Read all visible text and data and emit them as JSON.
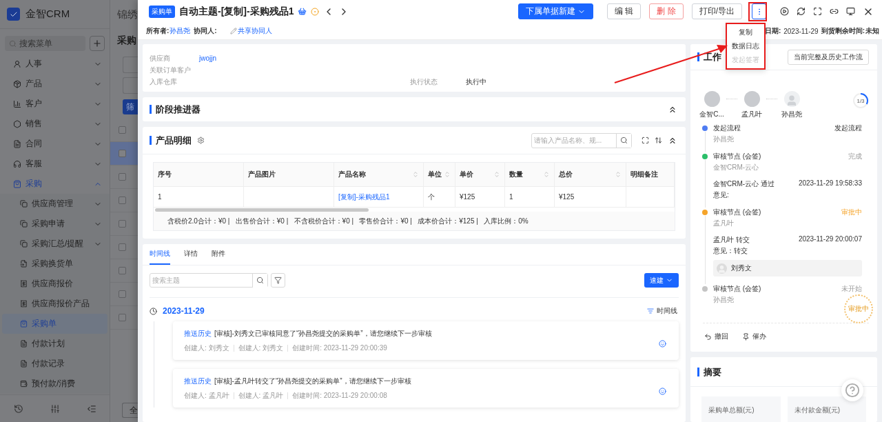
{
  "background": {
    "brand": "金智CRM",
    "menu_search": {
      "placeholder": "搜索菜单"
    },
    "menu": [
      {
        "label": "人事",
        "selected": false,
        "expanded": false
      },
      {
        "label": "产品",
        "selected": false,
        "expanded": false
      },
      {
        "label": "客户",
        "selected": false,
        "expanded": false
      },
      {
        "label": "销售",
        "selected": false,
        "expanded": false
      },
      {
        "label": "合同",
        "selected": false,
        "expanded": false
      },
      {
        "label": "客服",
        "selected": false,
        "expanded": false
      },
      {
        "label": "采购",
        "selected": false,
        "expanded": true,
        "children": [
          {
            "label": "供应商管理",
            "selected": false,
            "has_children": true
          },
          {
            "label": "采购申请",
            "selected": false,
            "has_children": true
          },
          {
            "label": "采购汇总/提醒",
            "selected": false,
            "has_children": true
          },
          {
            "label": "采购换货单",
            "selected": false,
            "has_children": false
          },
          {
            "label": "供应商报价",
            "selected": false,
            "has_children": false
          },
          {
            "label": "供应商报价产品",
            "selected": false,
            "has_children": false
          },
          {
            "label": "采购单",
            "selected": true,
            "has_children": false
          },
          {
            "label": "付款计划",
            "selected": false,
            "has_children": false
          },
          {
            "label": "付款记录",
            "selected": false,
            "has_children": false
          },
          {
            "label": "预付款/消费",
            "selected": false,
            "has_children": false
          }
        ]
      }
    ],
    "page_title": "锦绣",
    "list_title": "采购",
    "filter_button": "筛",
    "footer_button": "全",
    "list_rows": [
      {
        "checked": false,
        "selected": false
      },
      {
        "checked": false,
        "selected": true
      },
      {
        "checked": false,
        "selected": false
      },
      {
        "checked": false,
        "selected": false
      },
      {
        "checked": false,
        "selected": false
      },
      {
        "checked": false,
        "selected": false
      },
      {
        "checked": false,
        "selected": false
      },
      {
        "checked": false,
        "selected": false
      },
      {
        "checked": false,
        "selected": false
      }
    ]
  },
  "record": {
    "badge": "采购单",
    "title": "自动主题-[复制]-采购残品1"
  },
  "actions": [
    {
      "label": "下属单据新建",
      "kind": "primary"
    },
    {
      "label": "编 辑",
      "kind": "default"
    },
    {
      "label": "删 除",
      "kind": "danger"
    },
    {
      "label": "打印/导出",
      "kind": "default"
    }
  ],
  "more_menu": {
    "open": true,
    "items": [
      {
        "label": "复制",
        "disabled": false
      },
      {
        "label": "数据日志",
        "disabled": false
      },
      {
        "label": "发起签署",
        "disabled": true
      }
    ]
  },
  "meta": {
    "owner_label": "所有者:",
    "owner": "孙昌尧",
    "collab_label": "协同人:",
    "collab_link": "共享协同人",
    "date_label": "日期:",
    "date": "2023-11-29",
    "remaining_label": "到货剩余时间:",
    "remaining": "未知"
  },
  "info": {
    "fields": [
      {
        "label": "供应商",
        "value": "jwojjn"
      },
      {
        "label": "关联订单客户"
      },
      {
        "label": "入库仓库"
      }
    ],
    "status": {
      "label": "执行状态",
      "value": "执行中"
    }
  },
  "stage": {
    "title": "阶段推进器"
  },
  "products": {
    "title": "产品明细",
    "search": {
      "placeholder": "请输入产品名称、规..."
    },
    "columns": [
      {
        "label": "序号",
        "sortable": false,
        "kind": "text"
      },
      {
        "label": "产品图片",
        "sortable": false,
        "kind": "text"
      },
      {
        "label": "产品名称",
        "sortable": true,
        "kind": "link"
      },
      {
        "label": "单位",
        "sortable": true,
        "kind": "text"
      },
      {
        "label": "单价",
        "sortable": true,
        "kind": "text"
      },
      {
        "label": "数量",
        "sortable": true,
        "kind": "text"
      },
      {
        "label": "总价",
        "sortable": true,
        "kind": "text"
      },
      {
        "label": "明细备注",
        "sortable": false,
        "kind": "text"
      }
    ],
    "rows": [
      {
        "cells": [
          "1",
          null,
          "[复制]-采购残品1",
          "个",
          "¥125",
          "1",
          "¥125",
          null
        ]
      }
    ],
    "summary": "含税价2.0合计：¥0 |   出售价合计：¥0 |   不含税价合计：¥0 |   零售价合计：¥0 |   成本价合计：¥125 |   入库比例：0%"
  },
  "timeline": {
    "tabs": [
      {
        "label": "时间线",
        "selected": true
      },
      {
        "label": "详情",
        "selected": false
      },
      {
        "label": "附件",
        "selected": false
      }
    ],
    "search": {
      "placeholder": "搜索主题"
    },
    "quick_button": "速建",
    "date": "2023-11-29",
    "sort_label": "时间线",
    "entries": [
      {
        "tag": "推送历史",
        "text": "[审核]-刘秀文已审核同意了“孙昌尧提交的采购单”，请您继续下一步审核",
        "meta": [
          "创建人: 刘秀文",
          "创建人: 刘秀文",
          "创建时间: 2023-11-29 20:00:39"
        ]
      },
      {
        "tag": "推送历史",
        "text": "[审核]-孟凡叶转交了“孙昌尧提交的采购单”，请您继续下一步审核",
        "meta": [
          "创建人: 孟凡叶",
          "创建人: 孟凡叶",
          "创建时间: 2023-11-29 20:00:08"
        ]
      }
    ]
  },
  "workflow": {
    "title": "工作",
    "history_button": "当前完整及历史工作流",
    "people": [
      {
        "name": "金智C...",
        "photo": true
      },
      {
        "name": "孟凡叶",
        "photo": true
      },
      {
        "name": "孙昌尧",
        "photo": false
      }
    ],
    "progress": {
      "text": "1/3",
      "level": 0.33
    },
    "steps": [
      {
        "title": "发起流程",
        "person": "孙昌尧",
        "status": "发起流程",
        "color": "#4e7cf2",
        "current": false,
        "muted": false
      },
      {
        "title": "审核节点 (会签)",
        "person": "金智CRM-云心",
        "status": "完成",
        "color": "#2bbf6a",
        "current": false,
        "muted": true,
        "detail": {
          "action": "金智CRM-云心 通过",
          "time": "2023-11-29 19:58:33",
          "opinion": "意见:"
        }
      },
      {
        "title": "审核节点 (会签)",
        "person": "孟凡叶",
        "status": "审批中",
        "color": "#f5a42a",
        "current": true,
        "muted": false,
        "detail": {
          "action": "孟凡叶 转交",
          "time": "2023-11-29 20:00:07",
          "opinion": "意见：转交",
          "forward_to": "刘秀文"
        }
      },
      {
        "title": "审核节点 (会签)",
        "person": "孙昌尧",
        "status": "未开始",
        "color": "#c4c4c4",
        "current": false,
        "muted": true
      }
    ],
    "stamp": "审批中",
    "actions": [
      {
        "label": "撤回"
      },
      {
        "label": "催办"
      }
    ]
  },
  "digest": {
    "title": "摘要",
    "stats": [
      "采购单总额(元)",
      "未付款金额(元)"
    ]
  }
}
